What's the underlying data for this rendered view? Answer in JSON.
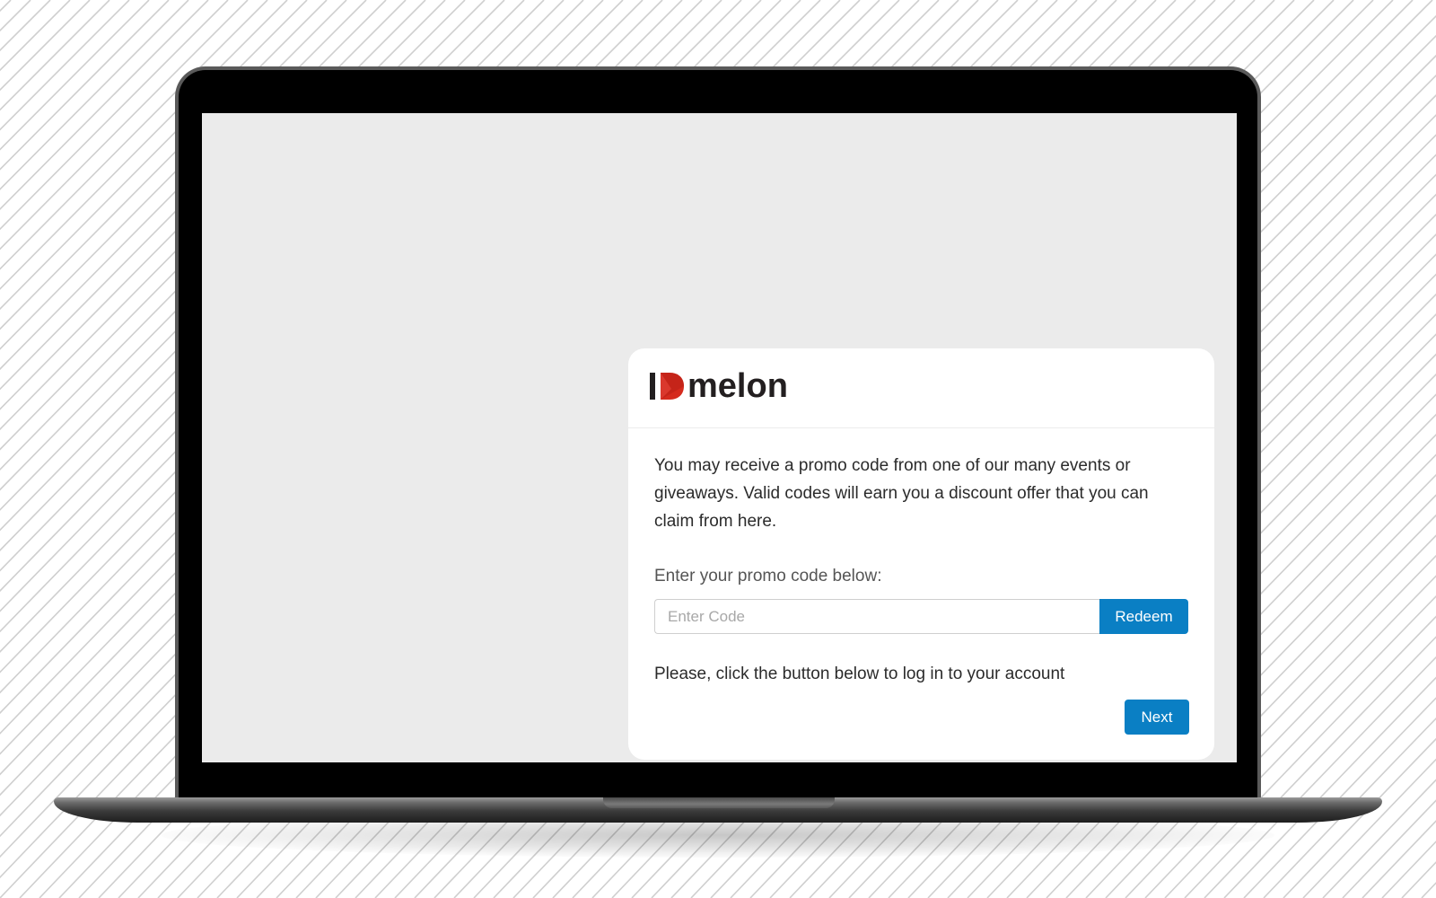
{
  "brand": {
    "logo_prefix": "I",
    "logo_word": "melon",
    "accent_color": "#d52b1e",
    "text_color": "#231f20"
  },
  "content": {
    "intro": "You may receive a promo code from one of our many events or giveaways. Valid codes will earn you a discount offer that you can claim from here.",
    "promo_label": "Enter your promo code below:",
    "login_text": "Please, click the button below to log in to your account"
  },
  "promo": {
    "placeholder": "Enter Code",
    "value": "",
    "redeem_label": "Redeem"
  },
  "actions": {
    "next_label": "Next"
  },
  "colors": {
    "button_bg": "#0a7fc4",
    "screen_bg": "#ebebeb",
    "card_bg": "#ffffff"
  }
}
